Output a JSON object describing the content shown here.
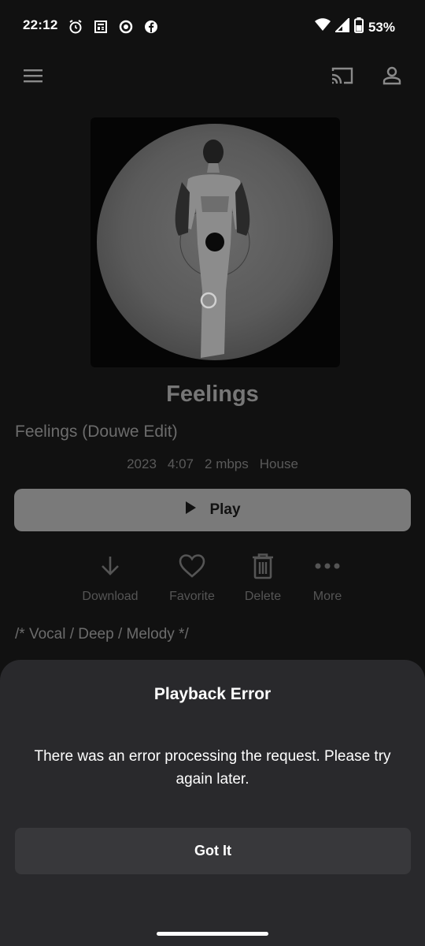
{
  "status_bar": {
    "time": "22:12",
    "battery_percent": "53%",
    "left_icons": [
      "alarm-icon",
      "news-icon",
      "circle-app-icon",
      "facebook-icon"
    ],
    "right_icons": [
      "wifi-icon",
      "signal-icon",
      "battery-icon"
    ]
  },
  "app_bar": {
    "icons": [
      "menu-icon",
      "cast-icon",
      "account-icon"
    ]
  },
  "track": {
    "title": "Feelings",
    "subtitle": "Feelings (Douwe Edit)",
    "year": "2023",
    "duration": "4:07",
    "bitrate": "2 mbps",
    "genre": "House",
    "tags": "/* Vocal / Deep / Melody */"
  },
  "play_button": {
    "label": "Play"
  },
  "actions": {
    "download": "Download",
    "favorite": "Favorite",
    "delete": "Delete",
    "more": "More"
  },
  "dialog": {
    "title": "Playback Error",
    "message": "There was an error processing the request. Please try again later.",
    "button": "Got It"
  },
  "colors": {
    "background": "#111111",
    "sheet": "#29292c",
    "sheet_button": "#38383b",
    "play_button": "#7a7a7a"
  }
}
